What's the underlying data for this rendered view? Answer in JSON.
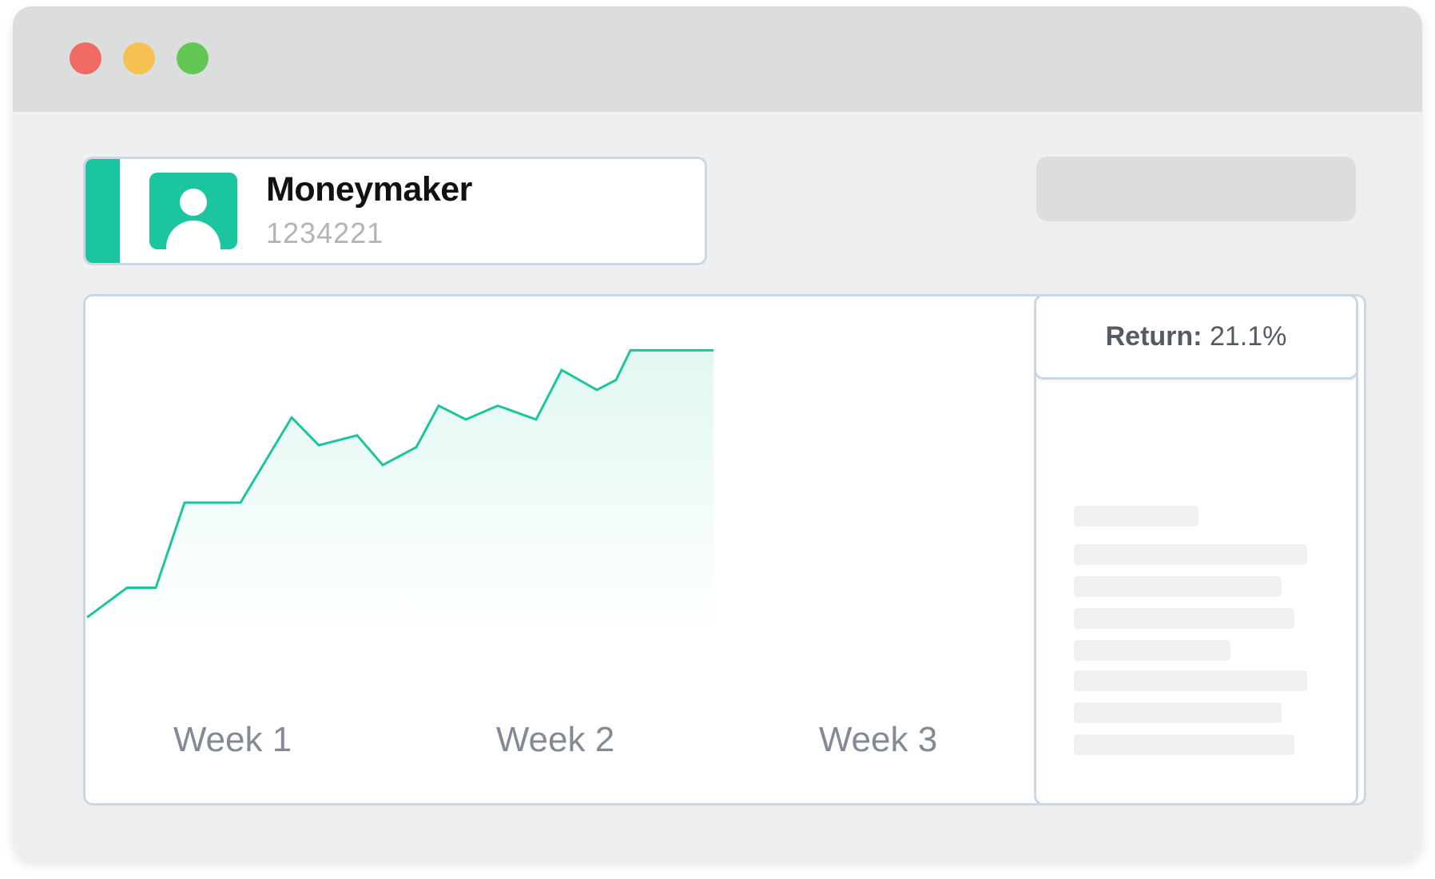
{
  "window": {
    "controls": [
      "close",
      "minimize",
      "maximize"
    ],
    "colors": {
      "close": "#ee6a62",
      "minimize": "#f6c150",
      "maximize": "#63c754"
    }
  },
  "account": {
    "name": "Moneymaker",
    "number": "1234221",
    "avatar_icon": "user-icon",
    "accent_color": "#1ac59f"
  },
  "chart_data": {
    "type": "area",
    "title": "",
    "xlabel": "",
    "ylabel": "",
    "x_ticks": [
      "Week 1",
      "Week 2",
      "Week 3"
    ],
    "series": [
      {
        "color": "#1ac59f",
        "values": [
          0.05,
          0.2,
          0.2,
          0.63,
          0.63,
          1.06,
          0.92,
          0.97,
          0.82,
          0.91,
          1.12,
          1.05,
          1.12,
          1.05,
          1.3,
          1.2,
          1.25,
          1.4,
          1.4
        ]
      }
    ]
  },
  "summary": {
    "return_label": "Return:",
    "return_value": "21.1%"
  }
}
